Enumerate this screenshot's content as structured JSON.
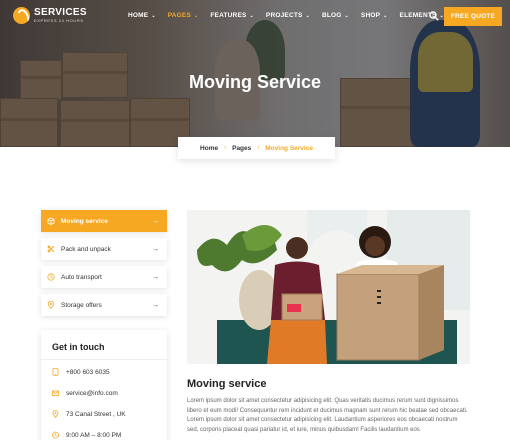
{
  "brand": {
    "name": "SERVICES",
    "tagline": "EXPRESS 24 HOURS"
  },
  "nav": {
    "items": [
      {
        "label": "HOME",
        "caret": "⌄",
        "active": false
      },
      {
        "label": "PAGES",
        "caret": "⌄",
        "active": true
      },
      {
        "label": "FEATURES",
        "caret": "⌄",
        "active": false
      },
      {
        "label": "PROJECTS",
        "caret": "⌄",
        "active": false
      },
      {
        "label": "BLOG",
        "caret": "⌄",
        "active": false
      },
      {
        "label": "SHOP",
        "caret": "⌄",
        "active": false
      },
      {
        "label": "ELEMENTS",
        "caret": "⌄",
        "active": false
      }
    ],
    "search_icon": "search-icon",
    "cta": "FREE QUOTE"
  },
  "hero": {
    "title": "Moving Service"
  },
  "breadcrumb": {
    "home": "Home",
    "sep": "›",
    "pages": "Pages",
    "current": "Moving Service"
  },
  "services_menu": [
    {
      "label": "Moving service",
      "icon": "box-icon",
      "arrow": "→",
      "active": true
    },
    {
      "label": "Pack and unpack",
      "icon": "tape-icon",
      "arrow": "→",
      "active": false
    },
    {
      "label": "Auto transport",
      "icon": "clock-icon",
      "arrow": "→",
      "active": false
    },
    {
      "label": "Storage offers",
      "icon": "location-icon",
      "arrow": "→",
      "active": false
    }
  ],
  "contact": {
    "title": "Get in touch",
    "phone": "+800 603 6035",
    "email": "service@info.com",
    "address": "73 Canal Street , UK",
    "hours": "9:00 AM – 8:00 PM"
  },
  "main": {
    "title": "Moving service",
    "body": "Lorem ipsum dolor sit amet consectetur adipisicing elit. Quas veritatis ducimus rerum sunt dignissimos libero et eum modi! Consequuntur rem incidunt et ducimus magnam sunt rerum hic beatae sed obcaecati. Lorem ipsum dolor sit amet consectetur adipisicing elit. Laudantium asperiores eos obcaecati nostrum sed, corporis placeat quasi pariatur id, et iure, minus quibusdam! Facilis laudantium eos"
  },
  "colors": {
    "accent": "#f7a823",
    "text": "#333333"
  }
}
